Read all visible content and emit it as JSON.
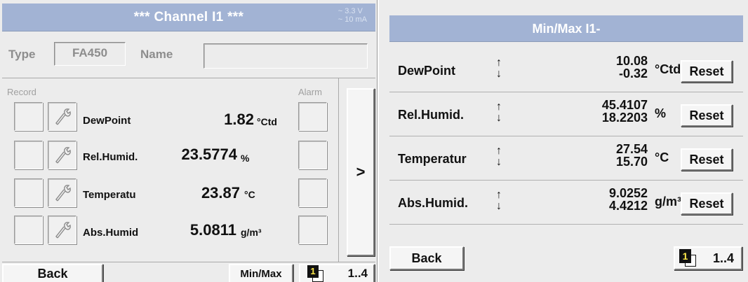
{
  "left_panel": {
    "header": {
      "title": "***  Channel I1  ***",
      "supply_voltage": "~ 3.3 V",
      "supply_current": "~ 10 mA"
    },
    "type_label": "Type",
    "type_value": "FA450",
    "name_label": "Name",
    "name_value": "",
    "record_label": "Record",
    "alarm_label": "Alarm",
    "rows": [
      {
        "name": "DewPoint",
        "value": "1.82",
        "unit": "°Ctd"
      },
      {
        "name": "Rel.Humid.",
        "value": "23.5774",
        "unit": "%"
      },
      {
        "name": "Temperatu",
        "value": "23.87",
        "unit": "°C"
      },
      {
        "name": "Abs.Humid",
        "value": "5.0811",
        "unit": "g/m³"
      }
    ],
    "next_label": ">",
    "back_label": "Back",
    "minmax_label": "Min/Max",
    "page_label": "1..4",
    "page_icon_number": "1"
  },
  "right_panel": {
    "header": {
      "title": "Min/Max I1-"
    },
    "rows": [
      {
        "name": "DewPoint",
        "max": "10.08",
        "min": "-0.32",
        "unit": "°Ctd",
        "reset_label": "Reset"
      },
      {
        "name": "Rel.Humid.",
        "max": "45.4107",
        "min": "18.2203",
        "unit": "%",
        "reset_label": "Reset"
      },
      {
        "name": "Temperatur",
        "max": "27.54",
        "min": "15.70",
        "unit": "°C",
        "reset_label": "Reset"
      },
      {
        "name": "Abs.Humid.",
        "max": "9.0252",
        "min": "4.4212",
        "unit": "g/m³",
        "reset_label": "Reset"
      }
    ],
    "arrow_up": "↑",
    "arrow_down": "↓",
    "back_label": "Back",
    "page_label": "1..4",
    "page_icon_number": "1"
  },
  "colors": {
    "header_bg": "#a2b3d4",
    "panel_bg": "#ececec",
    "header_text": "#ffffff"
  }
}
